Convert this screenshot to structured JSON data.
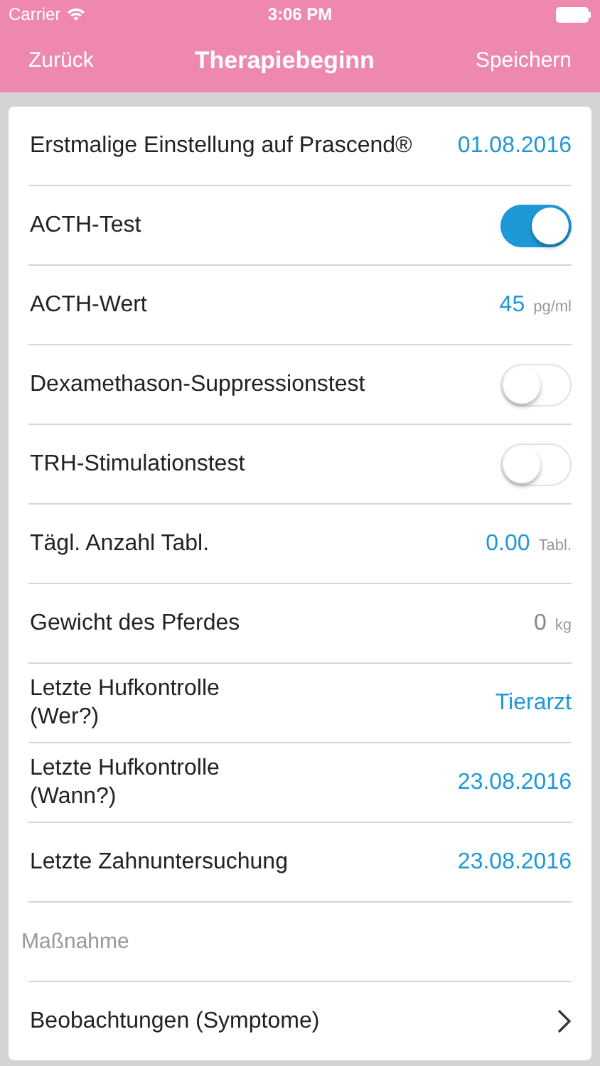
{
  "status_bar": {
    "carrier": "Carrier",
    "time": "3:06 PM"
  },
  "nav": {
    "back": "Zurück",
    "title": "Therapiebeginn",
    "action": "Speichern"
  },
  "rows": [
    {
      "kind": "value",
      "label": "Erstmalige Einstellung auf Prascend®",
      "value": "01.08.2016"
    },
    {
      "kind": "toggle",
      "label": "ACTH-Test",
      "on": true
    },
    {
      "kind": "measure",
      "label": "ACTH-Wert",
      "value": "45",
      "unit": "pg/ml",
      "empty": false
    },
    {
      "kind": "toggle",
      "label": "Dexamethason-Suppressionstest",
      "on": false
    },
    {
      "kind": "toggle",
      "label": "TRH-Stimulationstest",
      "on": false
    },
    {
      "kind": "measure",
      "label": "Tägl. Anzahl Tabl.",
      "value": "0.00",
      "unit": "Tabl.",
      "empty": false
    },
    {
      "kind": "measure",
      "label": "Gewicht des Pferdes",
      "value": "0",
      "unit": "kg",
      "empty": true
    },
    {
      "kind": "value",
      "label": "Letzte Hufkontrolle\n(Wer?)",
      "value": "Tierarzt"
    },
    {
      "kind": "value",
      "label": "Letzte Hufkontrolle\n(Wann?)",
      "value": "23.08.2016"
    },
    {
      "kind": "value",
      "label": "Letzte Zahnuntersuchung",
      "value": "23.08.2016"
    },
    {
      "kind": "input",
      "placeholder": "Maßnahme"
    },
    {
      "kind": "link",
      "label": "Beobachtungen (Symptome)"
    }
  ]
}
